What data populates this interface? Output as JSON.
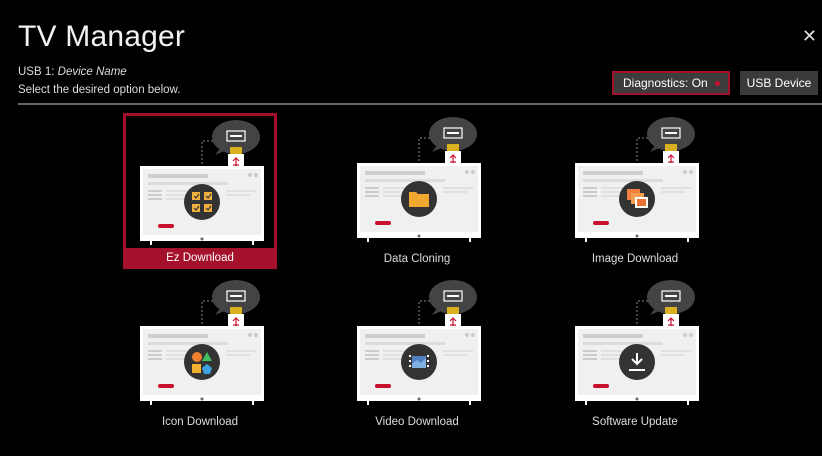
{
  "header": {
    "title": "TV Manager",
    "usb_prefix": "USB 1: ",
    "device_name": "Device Name",
    "instruction": "Select the desired option below.",
    "close_glyph": "✕"
  },
  "toolbar": {
    "diagnostics_label": "Diagnostics: On",
    "usb_device_label": "USB Device"
  },
  "options": [
    {
      "label": "Ez Download",
      "icon": "checklist-icon",
      "selected": true
    },
    {
      "label": "Data Cloning",
      "icon": "folder-icon",
      "selected": false
    },
    {
      "label": "Image Download",
      "icon": "images-icon",
      "selected": false
    },
    {
      "label": "Icon Download",
      "icon": "shapes-icon",
      "selected": false
    },
    {
      "label": "Video Download",
      "icon": "film-icon",
      "selected": false
    },
    {
      "label": "Software Update",
      "icon": "download-icon",
      "selected": false
    }
  ],
  "colors": {
    "accent": "#a5102a",
    "background": "#000000"
  }
}
